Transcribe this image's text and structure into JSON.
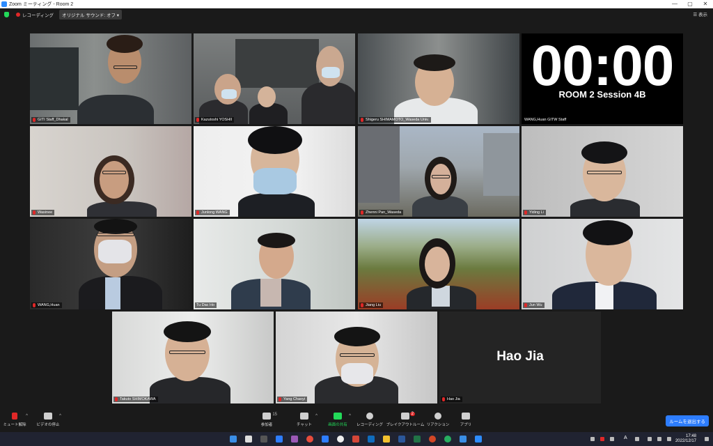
{
  "window": {
    "title": "Zoom ミーティング - Room 2",
    "controls": [
      "—",
      "▢",
      "✕"
    ]
  },
  "topbar": {
    "recording_label": "レコーディング",
    "sound_label": "オリジナル サウンド: オフ",
    "view_label": "表示"
  },
  "timer": {
    "time": "00:00",
    "session": "ROOM 2 Session 4B"
  },
  "participants": [
    {
      "name": "GITI Staff_Dhakal"
    },
    {
      "name": "Kazutoshi YOSHII"
    },
    {
      "name": "Shigeru SHIMAMOTO_Waseda Univ."
    },
    {
      "name": "WANG,Huan  GITW Staff"
    },
    {
      "name": "Wasinee"
    },
    {
      "name": "Junlong WANG"
    },
    {
      "name": "Zhenni Pan_Waseda"
    },
    {
      "name": "Yiding Li"
    },
    {
      "name": "WANG,Huan"
    },
    {
      "name": "Tu Dac Ho"
    },
    {
      "name": "Jiang Liu"
    },
    {
      "name": "Jun Wu"
    },
    {
      "name": "Takuto SHIMOKAWA"
    },
    {
      "name": "Yang Chaoyi"
    },
    {
      "name": "Hao Jia"
    }
  ],
  "big_name": "Hao Jia",
  "toolbar": {
    "mute": "ミュート解除",
    "video": "ビデオの停止",
    "participants": "参加者",
    "participants_count": "15",
    "chat": "チャット",
    "share": "画面の共有",
    "record": "レコーディング",
    "breakout": "ブレイクアウトルーム",
    "breakout_badge": "2",
    "reaction": "リアクション",
    "apps": "アプリ",
    "leave": "ルームを退出する"
  },
  "taskbar": {
    "time": "17:48",
    "date": "2022/12/17",
    "ime": "A"
  },
  "colors": {
    "accent": "#2d7dff",
    "active_speaker": "#a8d24a",
    "muted": "#e02828",
    "share": "#23d959"
  }
}
